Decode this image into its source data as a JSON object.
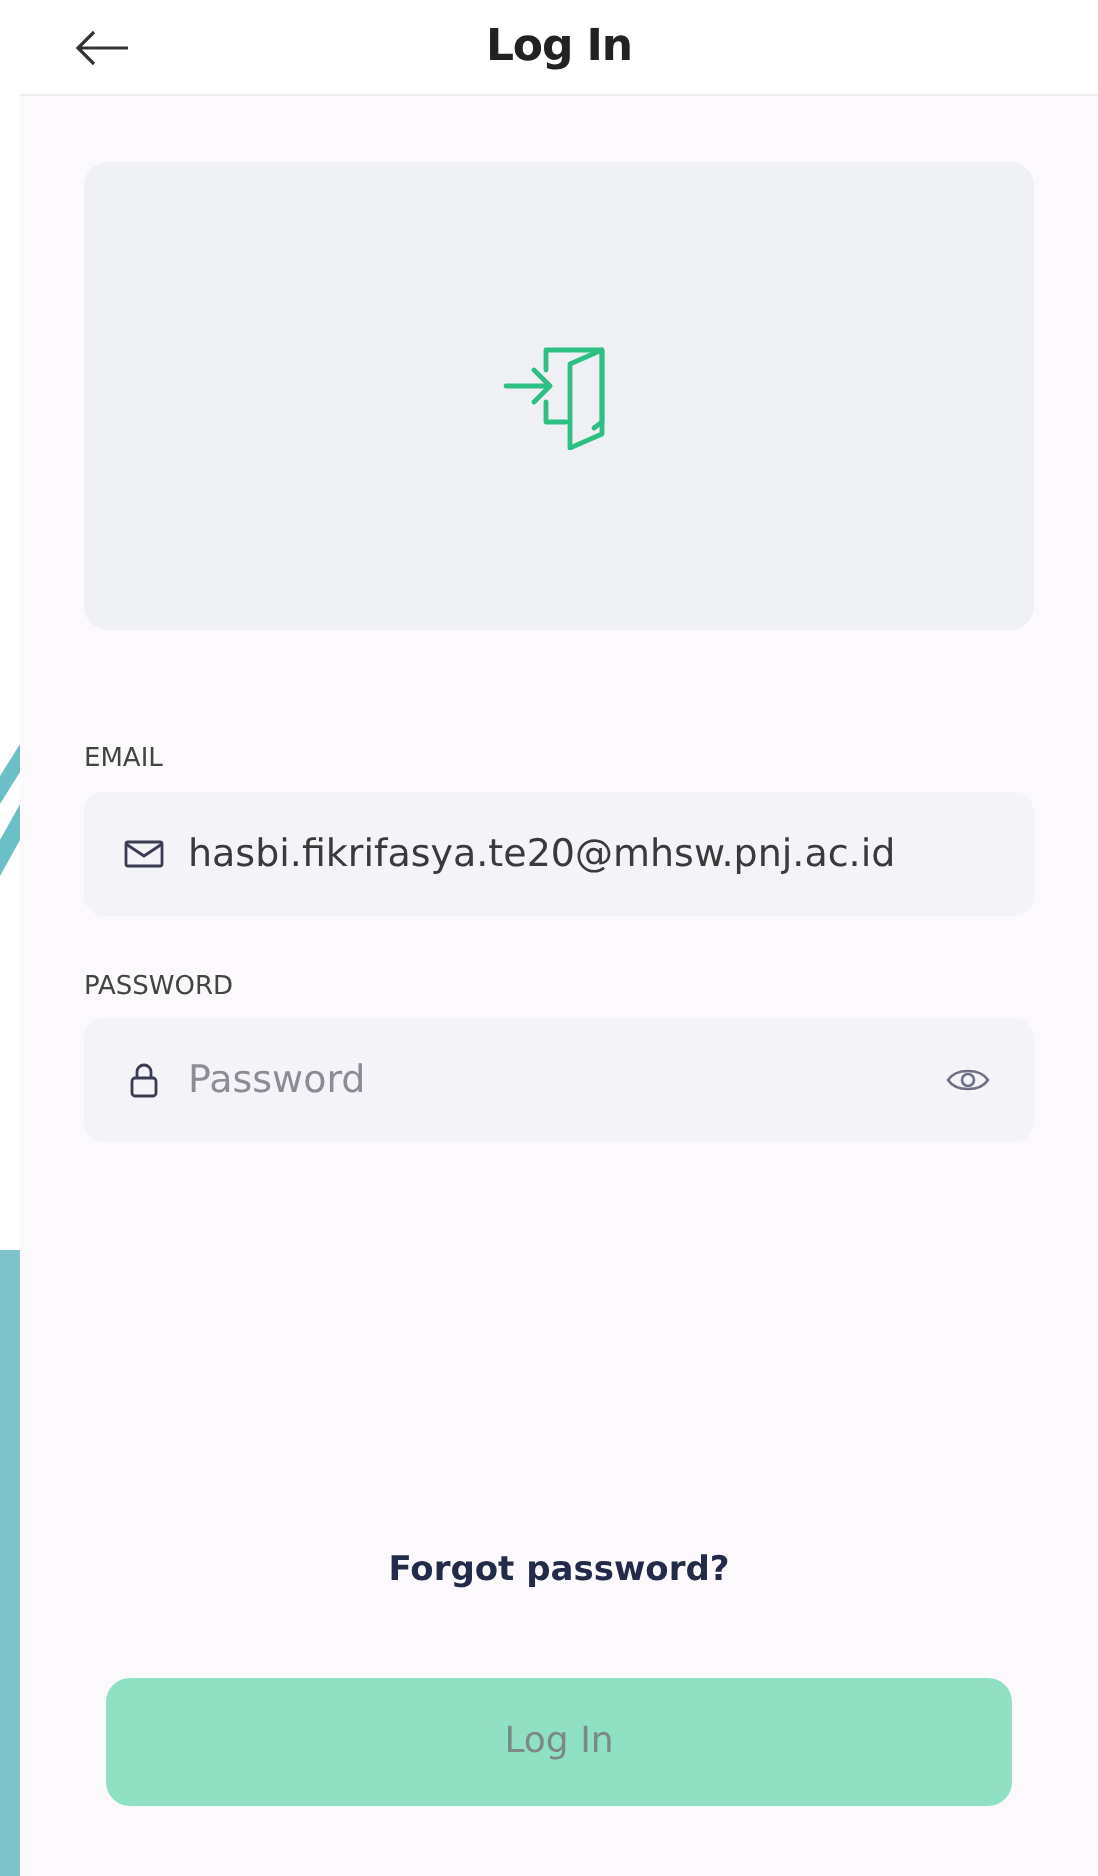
{
  "header": {
    "title": "Log In"
  },
  "email": {
    "label": "EMAIL",
    "value": "hasbi.fikrifasya.te20@mhsw.pnj.ac.id"
  },
  "password": {
    "label": "PASSWORD",
    "placeholder": "Password"
  },
  "forgot_link": "Forgot password?",
  "login_button": {
    "label": "Log In",
    "disabled": true
  }
}
